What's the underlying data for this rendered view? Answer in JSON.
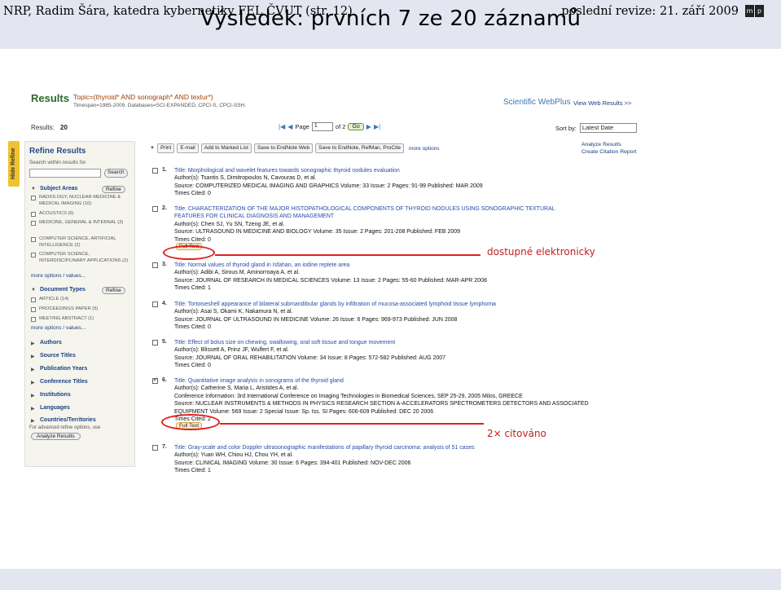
{
  "slide": {
    "title": "Výsledek: prvních 7 ze 20 záznamů",
    "footer_left": "NRP, Radim Šára, katedra kybernetiky FEL ČVUT (str. 12)",
    "footer_right": "poslední revize: 21. září 2009",
    "logo": [
      "m",
      "p"
    ]
  },
  "header": {
    "results_label": "Results",
    "topic": "Topic=(thyroid* AND sonograph* AND textur*)",
    "timespan": "Timespan=1985-2009. Databases=SCI-EXPANDED, CPCI-S, CPCI-SSH.",
    "webplus": "Scientific WebPlus",
    "view_web_results": "View Web Results >>"
  },
  "results_bar": {
    "label": "Results:",
    "count": "20",
    "page_label": "Page",
    "page_value": "1",
    "of_label": "of 2",
    "go_label": "Go",
    "sort_label": "Sort by:",
    "sort_value": "Latest Date"
  },
  "sidebar": {
    "hide_refine": "Hide Refine",
    "refine_title": "Refine Results",
    "search_within": "Search within results for",
    "search_button": "Search",
    "refine_button": "Refine",
    "subject_areas_title": "Subject Areas",
    "subject_areas": [
      "RADIOLOGY, NUCLEAR MEDICINE & MEDICAL IMAGING (10)",
      "ACOUSTICS (6)",
      "MEDICINE, GENERAL & INTERNAL (3)",
      "COMPUTER SCIENCE, ARTIFICIAL INTELLIGENCE (2)",
      "COMPUTER SCIENCE, INTERDISCIPLINARY APPLICATIONS (2)"
    ],
    "more_options": "more options / values...",
    "document_types_title": "Document Types",
    "document_types": [
      "ARTICLE (14)",
      "PROCEEDINGS PAPER (5)",
      "MEETING ABSTRACT (1)"
    ],
    "collapsed": [
      "Authors",
      "Source Titles",
      "Publication Years",
      "Conference Titles",
      "Institutions",
      "Languages",
      "Countries/Territories"
    ],
    "advanced_refine": "For advanced refine options, use",
    "analyze_results": "Analyze Results"
  },
  "toolbar": {
    "buttons": [
      "Print",
      "E-mail",
      "Add to Marked List",
      "Save to EndNote Web",
      "Save to EndNote, RefMan, ProCite"
    ],
    "more_options": "more options"
  },
  "right_links": {
    "analyze": "Analyze Results",
    "citation_report": "Create Citation Report"
  },
  "records": [
    {
      "num": "1.",
      "checked": false,
      "title_lines": [
        "Title: Morphological and wavelet features towards sonographic thyroid nodules evaluation"
      ],
      "authors": "Author(s): Tsantis S, Dimitropoulos N, Cavouras D, et al.",
      "source_lines": [
        "Source: COMPUTERIZED MEDICAL IMAGING AND GRAPHICS  Volume: 33  Issue: 2  Pages: 91-99  Published: MAR 2009"
      ],
      "cited": "Times Cited: 0",
      "fulltext": ""
    },
    {
      "num": "2.",
      "checked": false,
      "title_lines": [
        "Title: CHARACTERIZATION OF THE MAJOR HISTOPATHOLOGICAL COMPONENTS OF THYROID NODULES USING SONOGRAPHIC TEXTURAL",
        "FEATURES FOR CLINICAL DIAGNOSIS AND MANAGEMENT"
      ],
      "authors": "Author(s): Chen SJ, Yu SN, Tzeng JE, et al.",
      "source_lines": [
        "Source: ULTRASOUND IN MEDICINE AND BIOLOGY  Volume: 35  Issue: 2  Pages: 201-208  Published: FEB 2009"
      ],
      "cited": "Times Cited: 0",
      "fulltext": "Full Text"
    },
    {
      "num": "3.",
      "checked": false,
      "title_lines": [
        "Title: Normal values of thyroid gland in Isfahan, an iodine replete area"
      ],
      "authors": "Author(s): Adibi A, Sirous M, Aminorroaya A, et al.",
      "source_lines": [
        "Source: JOURNAL OF RESEARCH IN MEDICAL SCIENCES  Volume: 13  Issue: 2  Pages: 55-60  Published: MAR-APR 2008"
      ],
      "cited": "Times Cited: 1",
      "fulltext": ""
    },
    {
      "num": "4.",
      "checked": false,
      "title_lines": [
        "Title: Tortoiseshell appearance of bilateral submandibular glands by infiltration of mucosa-associated lymphoid tissue lymphoma"
      ],
      "authors": "Author(s): Asai S, Okami K, Nakamura N, et al.",
      "source_lines": [
        "Source: JOURNAL OF ULTRASOUND IN MEDICINE  Volume: 26  Issue: 6  Pages: 969-973  Published: JUN 2008"
      ],
      "cited": "Times Cited: 0",
      "fulltext": ""
    },
    {
      "num": "5.",
      "checked": false,
      "title_lines": [
        "Title: Effect of bolus size on chewing, swallowing, oral soft tissue and tongue movement"
      ],
      "authors": "Author(s): Blissett A, Prinz JF, Wulfert F, et al.",
      "source_lines": [
        "Source: JOURNAL OF ORAL REHABILITATION  Volume: 34  Issue: 8  Pages: 572-582  Published: AUG 2007"
      ],
      "cited": "Times Cited: 0",
      "fulltext": ""
    },
    {
      "num": "6.",
      "checked": true,
      "title_lines": [
        "Title: Quantitative image analysis in sonograms of the thyroid gland"
      ],
      "authors": "Author(s): Catherine S, Maria L, Aristides A, et al.",
      "source_lines": [
        "Conference Information: 3rd International Conference on Imaging Technologies in Biomedical Sciences, SEP 25-29, 2005 Milos, GREECE",
        "Source: NUCLEAR INSTRUMENTS & METHODS IN PHYSICS RESEARCH SECTION A-ACCELERATORS SPECTROMETERS DETECTORS AND ASSOCIATED",
        "EQUIPMENT  Volume: 569  Issue: 2  Special Issue: Sp. Iss. SI  Pages: 606-609  Published: DEC 20 2006"
      ],
      "cited": "Times Cited: 2",
      "fulltext": "Full Text"
    },
    {
      "num": "7.",
      "checked": false,
      "title_lines": [
        "Title: Gray-scale and color Doppler ultrasonographic manifestations of papillary thyroid carcinoma: analysis of 51 cases"
      ],
      "authors": "Author(s): Yuan WH, Chiou HJ, Chou YH, et al.",
      "source_lines": [
        "Source: CLINICAL IMAGING  Volume: 30  Issue: 6  Pages: 394-401  Published: NOV-DEC 2006"
      ],
      "cited": "Times Cited: 1",
      "fulltext": ""
    }
  ],
  "annotations": {
    "fulltext_note": "dostupné elektronicky",
    "cited_note": "2× citováno",
    "color": "#e02020"
  }
}
